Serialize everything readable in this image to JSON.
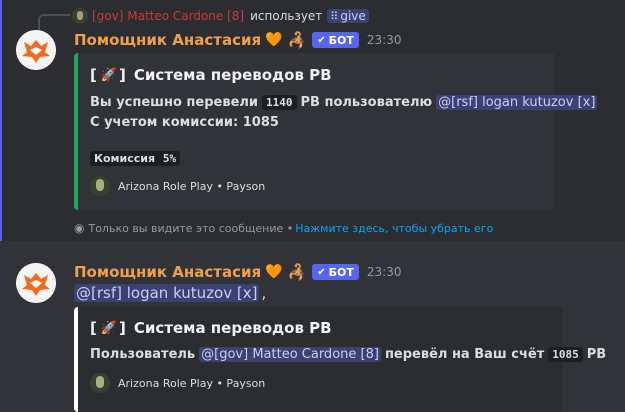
{
  "reply": {
    "username": "[gov] Matteo Cardone [8]",
    "text": "использует",
    "command": "give",
    "command_icon": "slash-command-icon"
  },
  "messages": [
    {
      "author": "Помощник Анастасия",
      "heart": "🧡",
      "decoration": "🦂",
      "bot_label": "БОТ",
      "time": "23:30",
      "embed": {
        "title_bracket_open": "[",
        "title_emoji": "🚀",
        "title_bracket_close": "]",
        "title": "Система переводов PB",
        "line1_prefix": "Вы успешно перевели",
        "line1_amount": "1140",
        "line1_mid": "PB пользователю",
        "line1_mention": "@[rsf] logan kutuzov [x]",
        "line2": "С учетом комиссии: 1085",
        "field_label": "Комиссия",
        "field_value": "5%",
        "footer": "Arizona Role Play • Payson"
      },
      "ephemeral_text": "Только вы видите это сообщение •",
      "dismiss_text": "Нажмите здесь, чтобы убрать его"
    },
    {
      "author": "Помощник Анастасия",
      "heart": "🧡",
      "decoration": "🦂",
      "bot_label": "БОТ",
      "time": "23:30",
      "mention": "@[rsf] logan kutuzov [x]",
      "comma": ",",
      "embed": {
        "title_bracket_open": "[",
        "title_emoji": "🚀",
        "title_bracket_close": "]",
        "title": "Система переводов PB",
        "line1_prefix": "Пользователь",
        "line1_mention": "@[gov] Matteo Cardone [8]",
        "line1_mid": "перевёл на Ваш счёт",
        "line1_amount": "1085",
        "line1_suffix": "PB",
        "footer": "Arizona Role Play • Payson"
      }
    }
  ],
  "colors": {
    "background": "#313338",
    "highlight": "#2b2d31",
    "username": "#f0a04b",
    "bot_badge": "#5865f2",
    "embed_border_1": "#23a55a",
    "embed_border_2": "#ffffff",
    "mention_bg": "#3c4270",
    "link": "#00a8fc"
  }
}
